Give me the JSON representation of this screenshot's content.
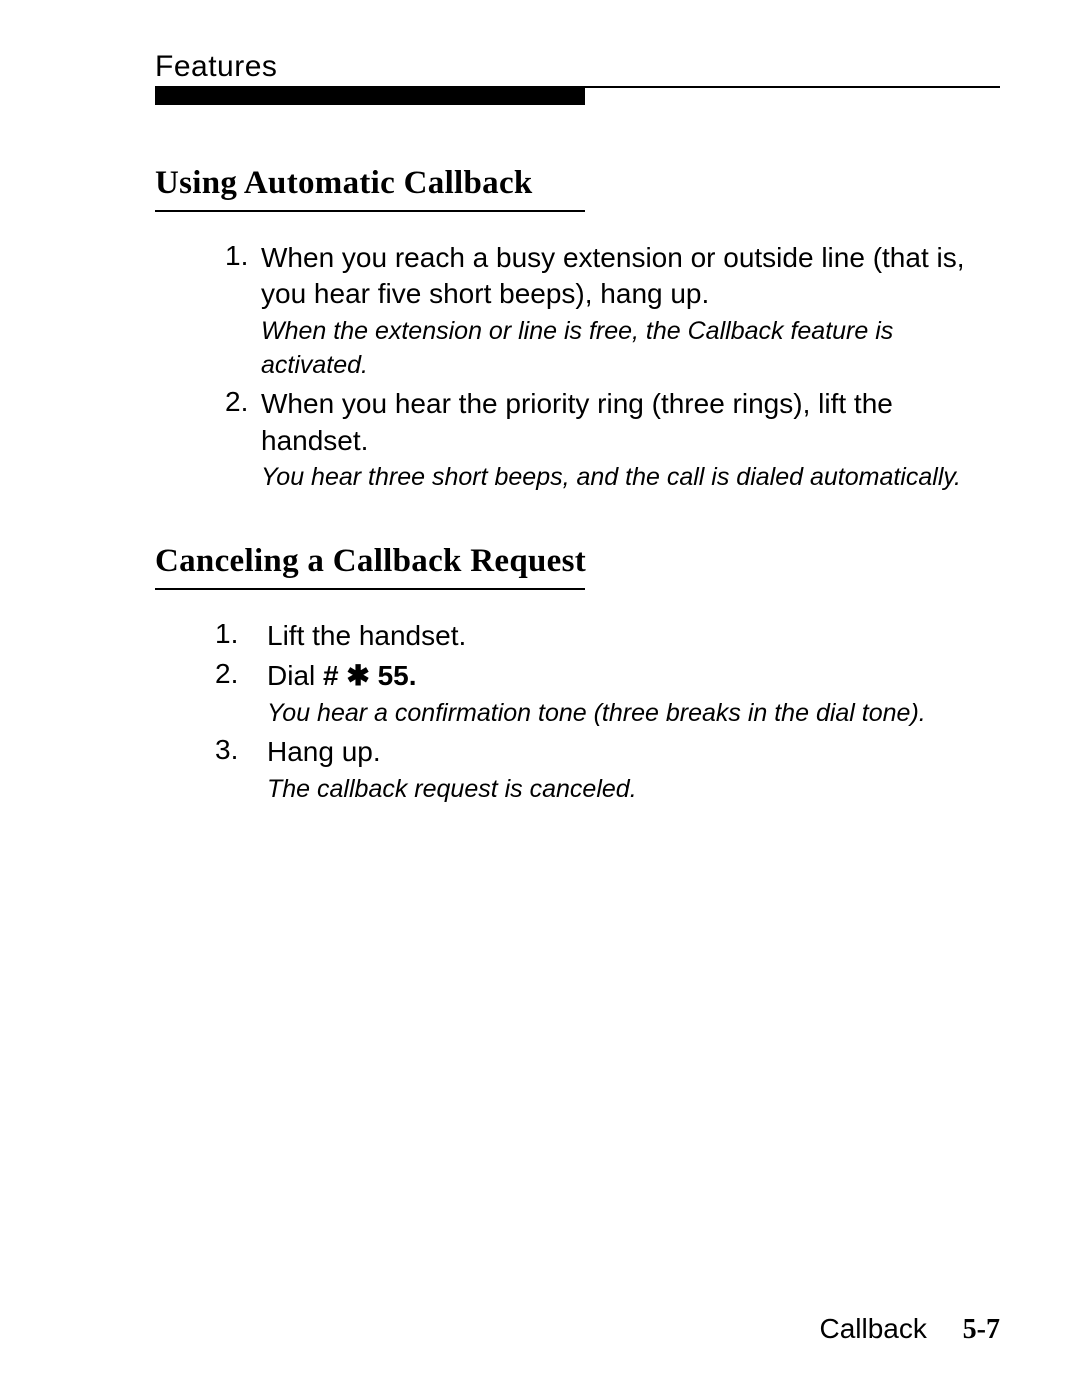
{
  "header": {
    "label": "Features"
  },
  "section1": {
    "title": "Using Automatic Callback",
    "steps": [
      {
        "num": "1.",
        "text": "When you reach a busy extension or outside line (that is, you hear five short beeps), hang up.",
        "note": "When the extension or line is free, the Callback feature is activated."
      },
      {
        "num": "2.",
        "text": "When you hear the priority ring (three rings), lift the handset.",
        "note": "You hear three short beeps, and the call is dialed automatically."
      }
    ]
  },
  "section2": {
    "title": "Canceling a Callback Request",
    "steps": [
      {
        "num": "1.",
        "text": "Lift the handset.",
        "note": ""
      },
      {
        "num": "2.",
        "textPrefix": "Dial ",
        "code": "# ✱ 55.",
        "note": "You hear a confirmation tone (three breaks in the dial tone)."
      },
      {
        "num": "3.",
        "text": "Hang up.",
        "note": "The callback request is canceled."
      }
    ]
  },
  "footer": {
    "label": "Callback",
    "page": "5-7"
  }
}
